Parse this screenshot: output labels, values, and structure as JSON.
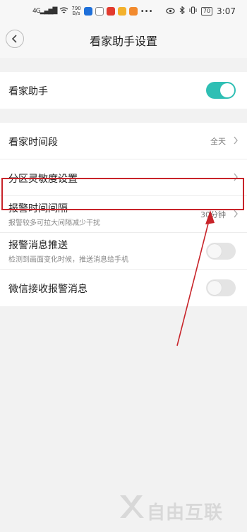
{
  "status_bar": {
    "signal_label": "4G",
    "net_speed_top": "790",
    "net_speed_unit": "B/s",
    "battery": "70",
    "time": "3:07"
  },
  "header": {
    "title": "看家助手设置",
    "back_icon": "chevron-left-icon"
  },
  "settings": {
    "assistant": {
      "label": "看家助手",
      "enabled": true
    },
    "time_period": {
      "label": "看家时间段",
      "value": "全天"
    },
    "sensitivity": {
      "label": "分区灵敏度设置"
    },
    "alarm_interval": {
      "label": "报警时间间隔",
      "subtitle": "报警较多可拉大间隔减少干扰",
      "value": "30分钟"
    },
    "push": {
      "label": "报警消息推送",
      "subtitle": "检测到画面变化时候，推送消息给手机",
      "enabled": false
    },
    "wechat": {
      "label": "微信接收报警消息",
      "enabled": false
    }
  },
  "colors": {
    "accent": "#2fbfb4",
    "highlight": "#c8242a"
  },
  "watermark": {
    "text": "自由互联"
  }
}
